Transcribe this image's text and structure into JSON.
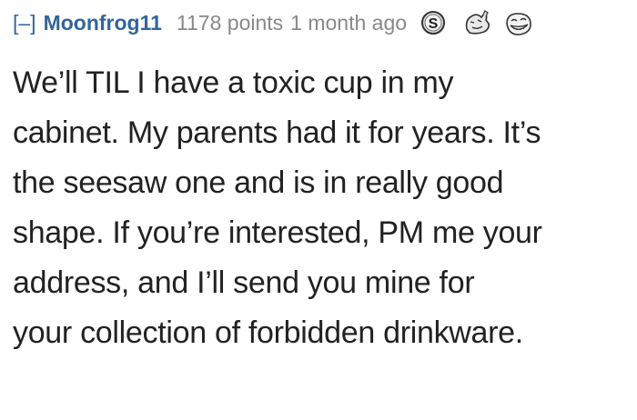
{
  "comment": {
    "collapse_label": "[–]",
    "author": "Moonfrog11",
    "score": "1178 points",
    "time": "1 month ago",
    "flair_icons": [
      "silver-s-badge-icon",
      "thumbs-up-meme-icon",
      "troll-face-icon"
    ],
    "body_lines": [
      "We’ll TIL I have a toxic cup in my",
      "cabinet. My parents had it for years. It’s",
      "the seesaw one and is in really good",
      "shape. If you’re interested, PM me your",
      "address, and I’ll send you mine for",
      "your collection of forbidden drinkware."
    ]
  },
  "colors": {
    "link": "#336699",
    "meta": "#888888",
    "text": "#222222"
  }
}
